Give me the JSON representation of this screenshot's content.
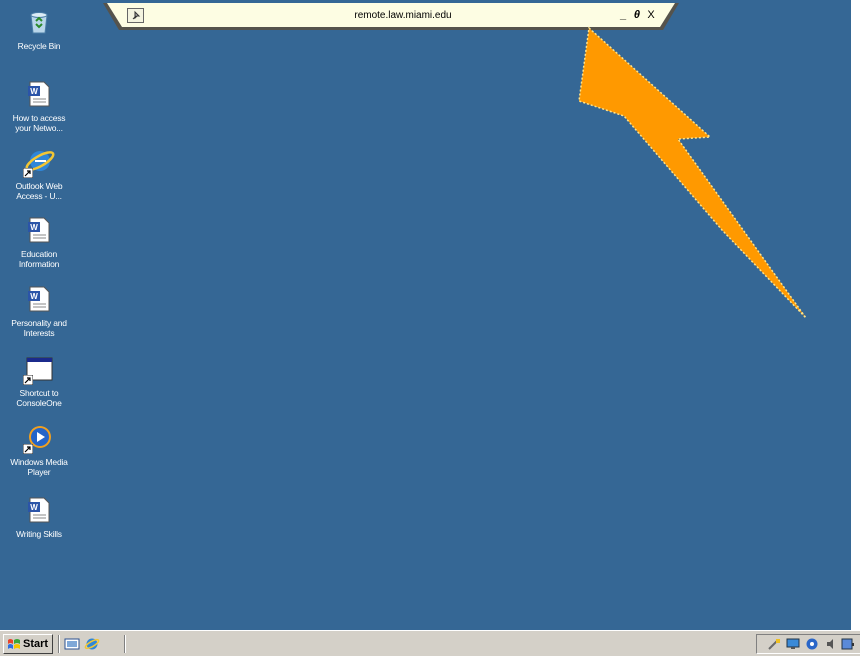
{
  "desktop": {
    "background_color": "#356795",
    "icons": [
      {
        "label": "Recycle Bin",
        "icon": "recycle-bin-icon"
      },
      {
        "label": "How to access\nyour Netwo...",
        "icon": "word-document-icon"
      },
      {
        "label": "Outlook Web\nAccess - U...",
        "icon": "internet-explorer-icon"
      },
      {
        "label": "Education\nInformation",
        "icon": "word-document-icon"
      },
      {
        "label": "Personality and\nInterests",
        "icon": "word-document-icon"
      },
      {
        "label": "Shortcut to\nConsoleOne",
        "icon": "console-window-icon"
      },
      {
        "label": "Windows Media\nPlayer",
        "icon": "windows-media-player-icon"
      },
      {
        "label": "Writing Skills",
        "icon": "word-document-icon"
      }
    ]
  },
  "connection_bar": {
    "title": "remote.law.miami.edu",
    "minimize_label": "_",
    "restore_label": "θ",
    "close_label": "X",
    "pin_icon": "pin-icon",
    "background_color": "#fdfde3"
  },
  "annotation": {
    "arrow_color": "#ff9900",
    "icon": "pointer-arrow"
  },
  "taskbar": {
    "start_label": "Start",
    "quick_launch": [
      "show-desktop-icon",
      "internet-explorer-icon"
    ],
    "tray_icons": [
      "network-icon",
      "monitor-icon",
      "security-icon",
      "speaker-icon",
      "app-icon"
    ]
  }
}
